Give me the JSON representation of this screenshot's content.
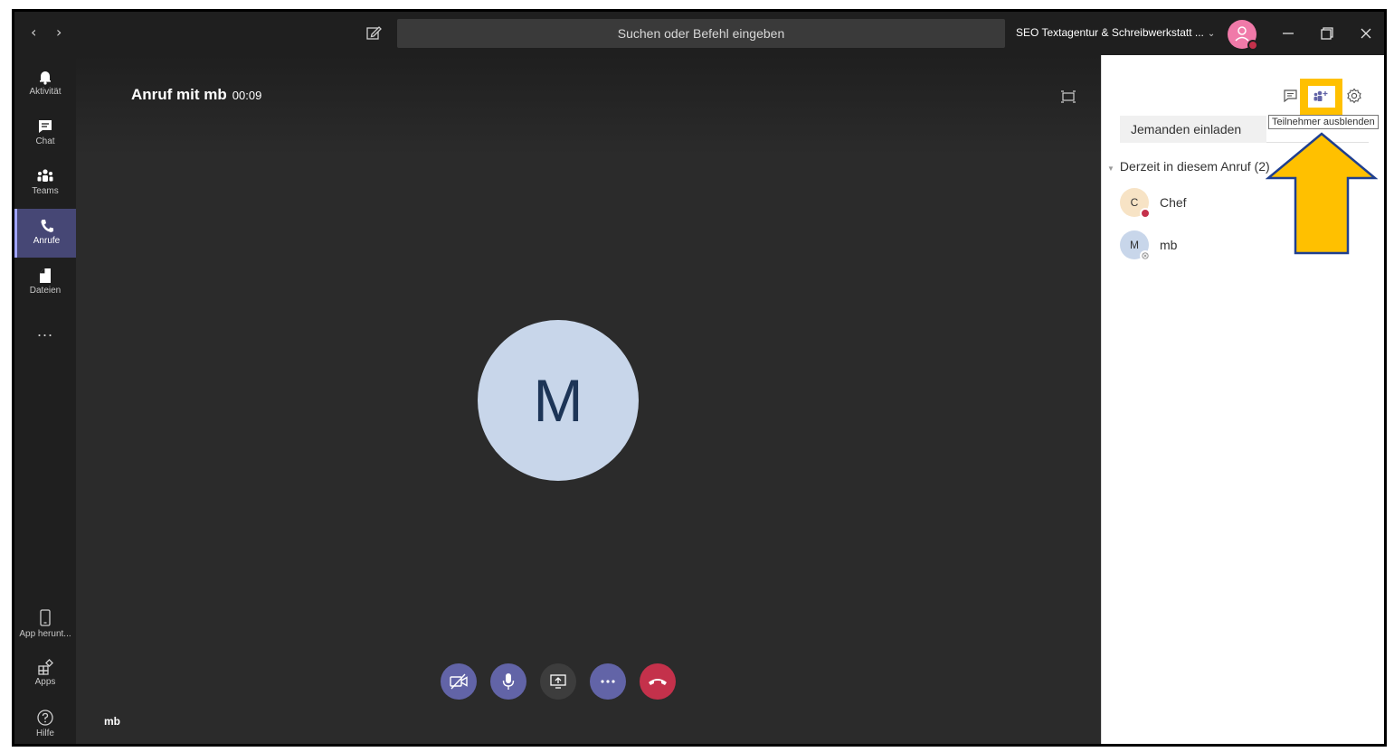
{
  "titlebar": {
    "back_glyph": "‹",
    "forward_glyph": "›",
    "search_placeholder": "Suchen oder Befehl eingeben",
    "org_name": "SEO Textagentur & Schreibwerkstatt ...",
    "org_chevron": "⌄",
    "minimize_glyph": "—",
    "close_glyph": "✕"
  },
  "rail": {
    "items": [
      {
        "label": "Aktivität",
        "icon": "bell-icon"
      },
      {
        "label": "Chat",
        "icon": "chat-icon"
      },
      {
        "label": "Teams",
        "icon": "teams-icon"
      },
      {
        "label": "Anrufe",
        "icon": "phone-icon",
        "active": true
      },
      {
        "label": "Dateien",
        "icon": "file-icon"
      }
    ],
    "more": "...",
    "bottom": [
      {
        "label": "App herunt...",
        "icon": "mobile-icon"
      },
      {
        "label": "Apps",
        "icon": "apps-icon"
      },
      {
        "label": "Hilfe",
        "icon": "help-icon"
      }
    ]
  },
  "call": {
    "title": "Anruf mit mb",
    "timer": "00:09",
    "remote_initial": "M",
    "self_name": "mb"
  },
  "panel": {
    "tooltip": "Teilnehmer ausblenden",
    "invite_placeholder": "Jemanden einladen",
    "section_caret": "▼",
    "section_title": "Derzeit in diesem Anruf (2)",
    "participants": [
      {
        "initial": "C",
        "name": "Chef",
        "avatar_color": "#f7e3c5",
        "status_color": "#c4314b"
      },
      {
        "initial": "M",
        "name": "mb",
        "avatar_color": "#c8d6ea",
        "status_color": "#ffffff"
      }
    ]
  },
  "colors": {
    "accent": "#6264a7",
    "hangup": "#c4314b",
    "highlight": "#ffc000",
    "annotation_arrow_fill": "#ffc000",
    "annotation_arrow_stroke": "#1f3f8f"
  }
}
